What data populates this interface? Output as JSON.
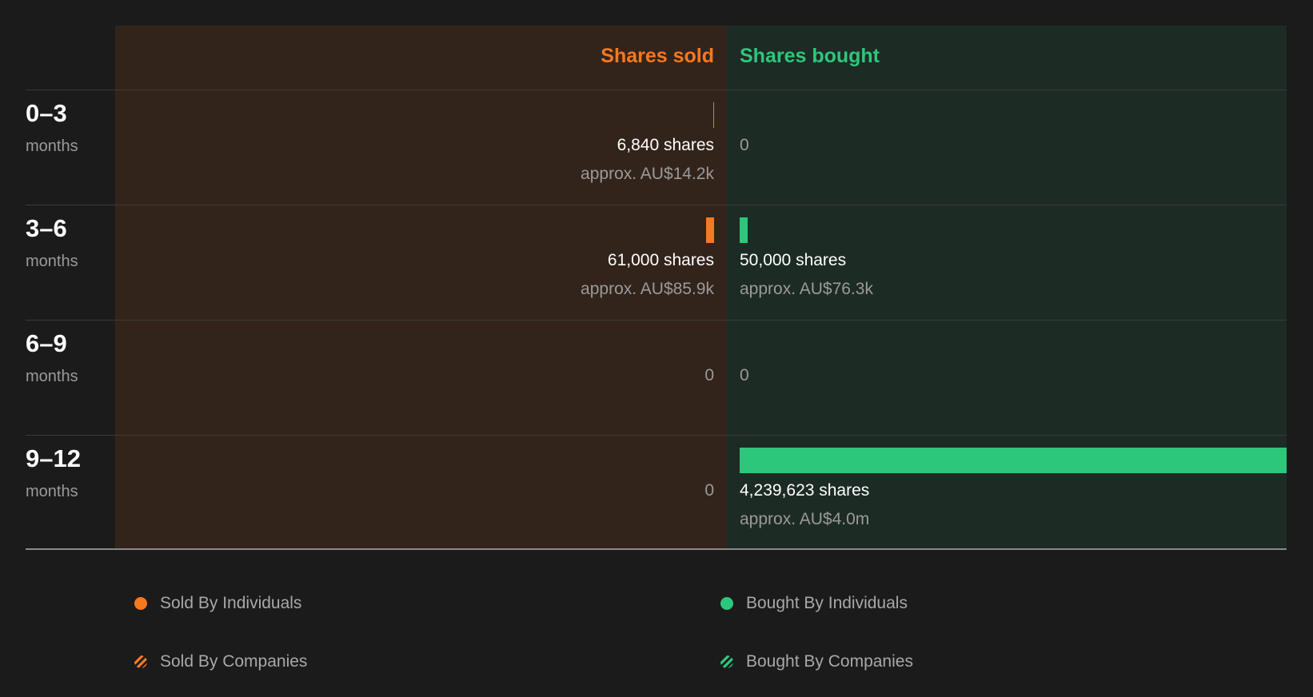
{
  "header": {
    "sold": "Shares sold",
    "bought": "Shares bought"
  },
  "colors": {
    "sold": "#f6781f",
    "bought": "#2dc77b",
    "sold_bg": "#33241b",
    "bought_bg": "#1d2b25"
  },
  "chart_data": {
    "type": "bar",
    "categories": [
      "0-3 months",
      "3-6 months",
      "6-9 months",
      "9-12 months"
    ],
    "series": [
      {
        "name": "Shares sold",
        "values": [
          6840,
          61000,
          0,
          0
        ]
      },
      {
        "name": "Shares bought",
        "values": [
          0,
          50000,
          0,
          4239623
        ]
      }
    ]
  },
  "rows": [
    {
      "range": "0–3",
      "unit": "months",
      "sold": {
        "shares": 6840,
        "shares_label": "6,840 shares",
        "approx": "approx. AU$14.2k",
        "zero": ""
      },
      "bought": {
        "shares": 0,
        "shares_label": "",
        "approx": "",
        "zero": "0"
      }
    },
    {
      "range": "3–6",
      "unit": "months",
      "sold": {
        "shares": 61000,
        "shares_label": "61,000 shares",
        "approx": "approx. AU$85.9k",
        "zero": ""
      },
      "bought": {
        "shares": 50000,
        "shares_label": "50,000 shares",
        "approx": "approx. AU$76.3k",
        "zero": ""
      }
    },
    {
      "range": "6–9",
      "unit": "months",
      "sold": {
        "shares": 0,
        "shares_label": "",
        "approx": "",
        "zero": "0"
      },
      "bought": {
        "shares": 0,
        "shares_label": "",
        "approx": "",
        "zero": "0"
      }
    },
    {
      "range": "9–12",
      "unit": "months",
      "sold": {
        "shares": 0,
        "shares_label": "",
        "approx": "",
        "zero": "0"
      },
      "bought": {
        "shares": 4239623,
        "shares_label": "4,239,623 shares",
        "approx": "approx. AU$4.0m",
        "zero": ""
      }
    }
  ],
  "legend": {
    "sold_individuals": "Sold By Individuals",
    "sold_companies": "Sold By Companies",
    "bought_individuals": "Bought By Individuals",
    "bought_companies": "Bought By Companies"
  }
}
